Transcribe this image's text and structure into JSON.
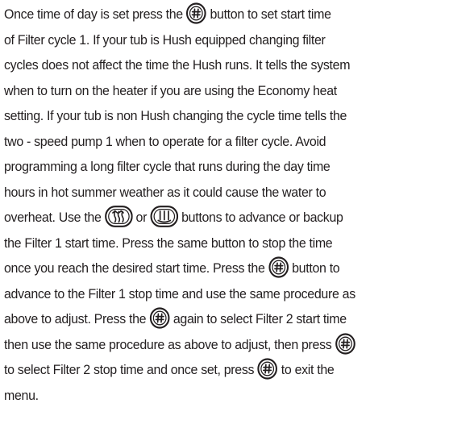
{
  "paragraph": {
    "l1a": "Once time of day is set press the ",
    "l1b": " button to set start time",
    "l2": "of Filter cycle 1. If your tub is Hush equipped changing filter",
    "l3": "cycles does not affect the time the Hush runs. It tells the system",
    "l4": "when to turn on the heater if you are using the Economy heat",
    "l5": "setting. If your tub is non Hush changing the cycle time tells the",
    "l6": "two - speed pump 1 when to operate for a filter cycle. Avoid",
    "l7": "programming a long filter cycle that runs during the day time",
    "l8": "hours in hot summer weather as it could cause the water to",
    "l9a": "overheat. Use the ",
    "l9b": " or ",
    "l9c": " buttons to advance or backup",
    "l10": "the Filter 1 start time. Press the same button to stop the time",
    "l11a": "once you reach the desired start time. Press the ",
    "l11b": " button to",
    "l12": "advance to the Filter 1 stop time and use the same procedure as",
    "l13a": "above to adjust. Press the ",
    "l13b": " again to select Filter 2 start time",
    "l14a": "then use the same procedure as above to adjust, then press ",
    "l15a": "to select Filter 2 stop time and once set, press ",
    "l15b": " to exit the",
    "l16": "menu."
  },
  "icons": {
    "mode": "mode-button-icon",
    "warm": "warm-button-icon",
    "cool": "cool-button-icon"
  },
  "colors": {
    "text": "#231f20",
    "icon_fill": "#ffffff",
    "icon_stroke": "#231f20"
  }
}
